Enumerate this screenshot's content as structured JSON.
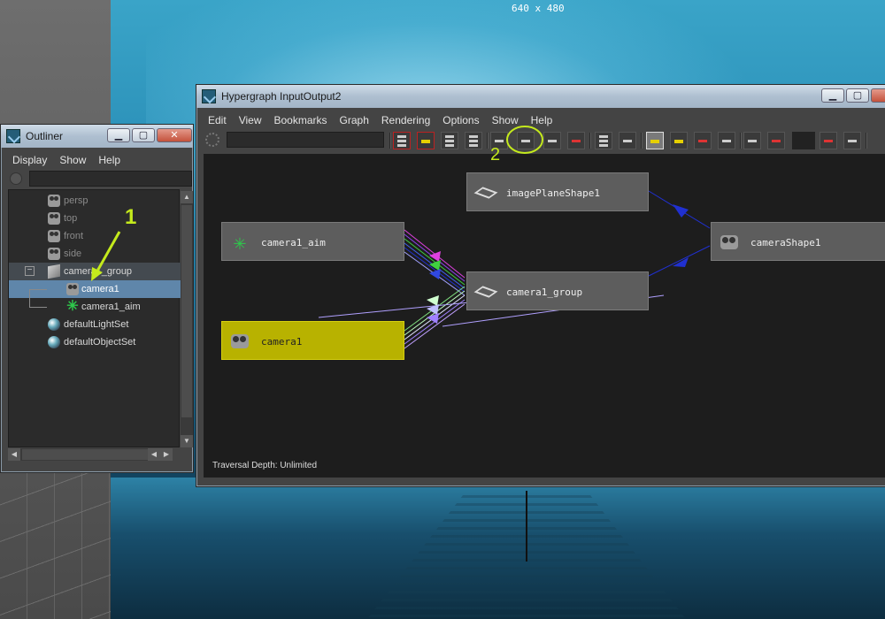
{
  "viewport": {
    "resolution_label": "640 x 480"
  },
  "outliner": {
    "title": "Outliner",
    "menu": [
      "Display",
      "Show",
      "Help"
    ],
    "items": [
      {
        "label": "persp",
        "icon": "camera-icon"
      },
      {
        "label": "top",
        "icon": "camera-icon"
      },
      {
        "label": "front",
        "icon": "camera-icon"
      },
      {
        "label": "side",
        "icon": "camera-icon"
      },
      {
        "label": "camera1_group",
        "icon": "group-icon",
        "expand": "−"
      },
      {
        "label": "camera1",
        "icon": "camera-icon"
      },
      {
        "label": "camera1_aim",
        "icon": "aim-locator-icon"
      },
      {
        "label": "defaultLightSet",
        "icon": "set-icon"
      },
      {
        "label": "defaultObjectSet",
        "icon": "set-icon"
      }
    ]
  },
  "hypergraph": {
    "title": "Hypergraph InputOutput2",
    "menu": [
      "Edit",
      "View",
      "Bookmarks",
      "Graph",
      "Rendering",
      "Options",
      "Show",
      "Help"
    ],
    "nodes": {
      "image_plane": "imagePlaneShape1",
      "camera_aim": "camera1_aim",
      "camera_shape": "cameraShape1",
      "camera_group": "camera1_group",
      "camera": "camera1"
    },
    "status": "Traversal Depth: Unlimited"
  },
  "annotations": {
    "one": "1",
    "two": "2"
  },
  "colors": {
    "selected_node": "#b8b200",
    "selected_row": "#5f86aa",
    "annotation": "#c4ea1c"
  }
}
